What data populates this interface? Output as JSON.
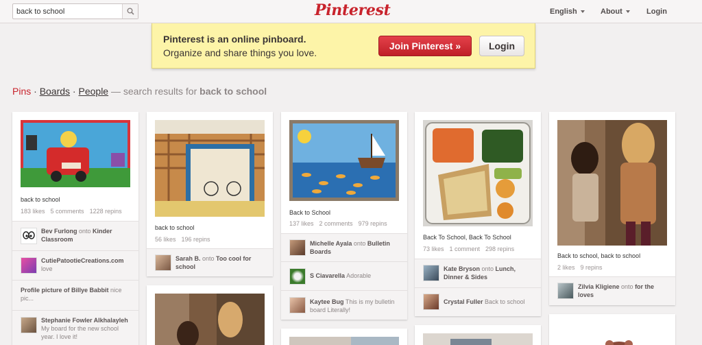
{
  "search": {
    "value": "back to school"
  },
  "header": {
    "logo": "Pinterest",
    "language": "English",
    "about": "About",
    "login": "Login"
  },
  "banner": {
    "title": "Pinterest is an online pinboard.",
    "subtitle": "Organize and share things you love.",
    "join_label": "Join Pinterest »",
    "login_label": "Login"
  },
  "breadcrumb": {
    "pins": "Pins",
    "dot1": " · ",
    "boards": "Boards",
    "dot2": " · ",
    "people": "People",
    "dash": " — search results for ",
    "query": "back to school"
  },
  "pins": [
    {
      "description": "back to school",
      "likes": "183 likes",
      "comments": "5 comments",
      "repins": "1228 repins",
      "activity": [
        {
          "user": "Bev Furlong",
          "mid": " onto ",
          "board": "Kinder Classroom"
        },
        {
          "user": "CutiePatootieCreations.com",
          "mid": "",
          "board": "",
          "note": "love"
        },
        {
          "user": "Profile picture of",
          "mid": " Billye Babbit",
          "board": "",
          "note": "nice pic..."
        },
        {
          "user": "Stephanie Fowler Alkhalayleh",
          "mid": "",
          "board": "",
          "note": "My board for the new school year. I love it!"
        }
      ]
    },
    {
      "description": "back to school",
      "likes": "56 likes",
      "repins": "196 repins",
      "activity": [
        {
          "user": "Sarah B.",
          "mid": " onto ",
          "board": "Too cool for school"
        }
      ]
    },
    {
      "description": "Back to School",
      "likes": "137 likes",
      "comments": "2 comments",
      "repins": "979 repins",
      "activity": [
        {
          "user": "Michelle Ayala",
          "mid": " onto ",
          "board": "Bulletin Boards"
        },
        {
          "user": "S Ciavarella",
          "mid": "",
          "board": "",
          "note": "Adorable"
        },
        {
          "user": "Kaytee Bug",
          "mid": "",
          "board": "",
          "note": "This is my bulletin board Literally!"
        }
      ]
    },
    {
      "description": "Back To School, Back To School",
      "likes": "73 likes",
      "comments": "1 comment",
      "repins": "298 repins",
      "activity": [
        {
          "user": "Kate Bryson",
          "mid": " onto ",
          "board": "Lunch, Dinner & Sides"
        },
        {
          "user": "Crystal Fuller",
          "mid": "",
          "board": "",
          "note": "Back to school"
        }
      ]
    },
    {
      "description": "Back to school, back to school",
      "likes": "2 likes",
      "repins": "9 repins",
      "activity": [
        {
          "user": "Zilvia Kligiene",
          "mid": " onto ",
          "board": "for the loves"
        }
      ]
    }
  ],
  "colors": {
    "brand_red": "#c8232c",
    "banner_yellow": "#fdf4a8",
    "background": "#f2f0f0"
  }
}
